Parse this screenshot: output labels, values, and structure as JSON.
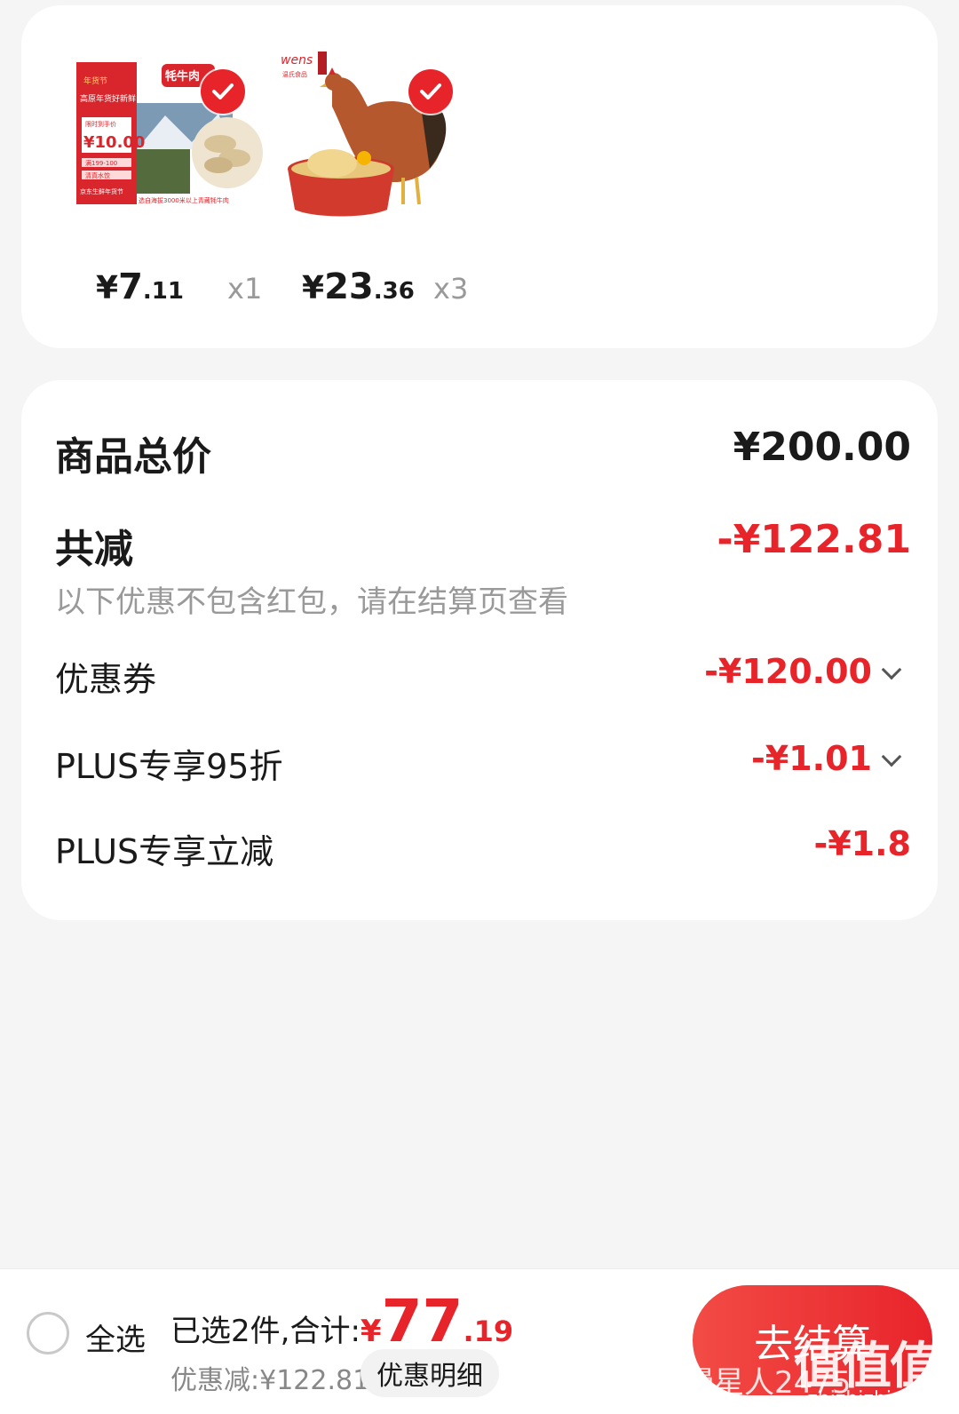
{
  "products": [
    {
      "price_currency": "¥",
      "price_int": "7",
      "price_dec": ".11",
      "quantity": "x1",
      "image_texts": {
        "badge": "年货节",
        "title": "牦牛肉",
        "promo": "高原年货好新鲜",
        "label": "限时到手价",
        "price": "¥10.00",
        "coupon1": "满199-100",
        "coupon2": "清真水饺",
        "footer": "京东生鲜年货节",
        "caption": "选自海拔3000米以上青藏牦牛肉"
      }
    },
    {
      "price_currency": "¥",
      "price_int": "23",
      "price_dec": ".36",
      "quantity": "x3",
      "image_texts": {
        "brand": "wens",
        "brand_sub": "温氏食品"
      }
    }
  ],
  "summary": {
    "total_label": "商品总价",
    "total_value": "¥200.00",
    "reduce_label": "共减",
    "reduce_value": "-¥122.81",
    "note": "以下优惠不包含红包，请在结算页查看",
    "items": [
      {
        "label": "优惠券",
        "value": "-¥120.00",
        "expandable": true
      },
      {
        "label": "PLUS专享95折",
        "value": "-¥1.01",
        "expandable": true
      },
      {
        "label": "PLUS专享立减",
        "value": "-¥1.8",
        "expandable": false
      }
    ]
  },
  "bottom_bar": {
    "select_all": "全选",
    "selected_text": "已选2件,合计:",
    "total_currency": "¥",
    "total_int": "77",
    "total_dec": ".19",
    "discount_text": "优惠减:¥122.81",
    "detail_button": "优惠明细",
    "checkout_button": "去结算",
    "watermark_user": "慢星人2475",
    "watermark_site": "zhizhizhi.com",
    "watermark_logo": "值值值"
  },
  "colors": {
    "accent": "#e8242b",
    "background": "#f5f5f5",
    "muted": "#999999"
  }
}
